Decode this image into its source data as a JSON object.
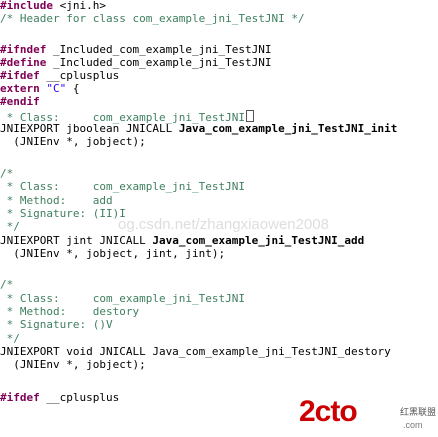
{
  "code": {
    "l1_kw": "#include",
    "l1_text": " <jni.h>",
    "l2": "/* Header for class com_example_jni_TestJNI */",
    "l3_kw": "#ifndef",
    "l3_text": " _Included_com_example_jni_TestJNI",
    "l4_kw": "#define",
    "l4_text": " _Included_com_example_jni_TestJNI",
    "l5_kw": "#ifdef",
    "l5_text": " __cplusplus",
    "l6_kw": "extern",
    "l6_str": " \"C\"",
    "l6_text": " {",
    "l7_kw": "#endif",
    "l8": " * Class:     com_example_jni_TestJNI",
    "l9_a": "JNIEXPORT jboolean JNICALL ",
    "l9_b": "Java_com_example_jni_TestJNI_init",
    "l10": "  (JNIEnv *, jobject);",
    "l11": "/*",
    "l12": " * Class:     com_example_jni_TestJNI",
    "l13": " * Method:    add",
    "l14": " * Signature: (II)I",
    "l15": " */",
    "l16_a": "JNIEXPORT jint JNICALL ",
    "l16_b": "Java_com_example_jni_TestJNI_add",
    "l17": "  (JNIEnv *, jobject, jint, jint);",
    "l18": "/*",
    "l19": " * Class:     com_example_jni_TestJNI",
    "l20": " * Method:    destory",
    "l21": " * Signature: ()V",
    "l22": " */",
    "l23": "JNIEXPORT void JNICALL Java_com_example_jni_TestJNI_destory",
    "l24": "  (JNIEnv *, jobject);",
    "l25_kw": "#ifdef",
    "l25_text": " __cplusplus"
  },
  "watermark": {
    "url": "og.csdn.net/zhangxiaowen2008"
  },
  "logo": {
    "main": "2cto",
    "sub": "红黑联盟",
    "url": ".com"
  },
  "colors": {
    "keyword": "#7f0055",
    "comment": "#3f7f5f",
    "string": "#2a00ff",
    "logo": "#cc0000"
  }
}
